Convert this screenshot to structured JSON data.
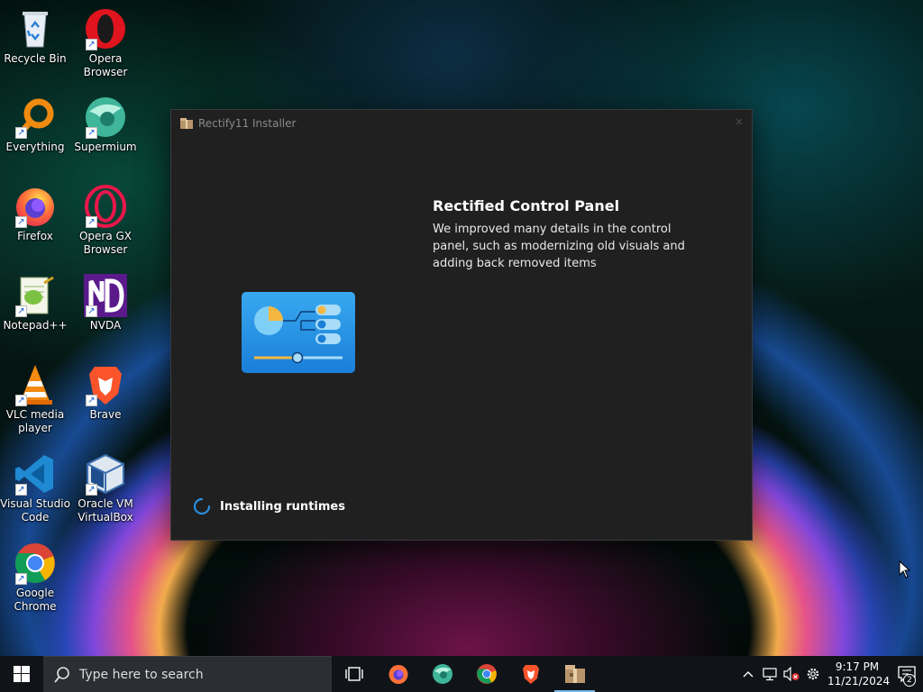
{
  "desktop": {
    "icons": [
      {
        "label": "Recycle Bin",
        "icon": "recycle-bin-icon",
        "shortcut": false
      },
      {
        "label": "Opera Browser",
        "icon": "opera-icon",
        "shortcut": true
      },
      {
        "label": "Everything",
        "icon": "everything-icon",
        "shortcut": true
      },
      {
        "label": "Supermium",
        "icon": "supermium-icon",
        "shortcut": true
      },
      {
        "label": "Firefox",
        "icon": "firefox-icon",
        "shortcut": true
      },
      {
        "label": "Opera GX Browser",
        "icon": "opera-gx-icon",
        "shortcut": true
      },
      {
        "label": "Notepad++",
        "icon": "notepad-plus-plus-icon",
        "shortcut": true
      },
      {
        "label": "NVDA",
        "icon": "nvda-icon",
        "shortcut": true
      },
      {
        "label": "VLC media player",
        "icon": "vlc-icon",
        "shortcut": true
      },
      {
        "label": "Brave",
        "icon": "brave-icon",
        "shortcut": true
      },
      {
        "label": "Visual Studio Code",
        "icon": "vscode-icon",
        "shortcut": true
      },
      {
        "label": "Oracle VM VirtualBox",
        "icon": "virtualbox-icon",
        "shortcut": true
      },
      {
        "label": "Google Chrome",
        "icon": "chrome-icon",
        "shortcut": true
      }
    ]
  },
  "installer": {
    "title": "Rectify11 Installer",
    "feature_title": "Rectified Control Panel",
    "feature_description": "We improved many details in the control panel, such as modernizing old visuals and adding back removed items",
    "status": "Installing runtimes",
    "accent": "#2a8fe0"
  },
  "taskbar": {
    "search_placeholder": "Type here to search",
    "apps": [
      {
        "name": "task-view",
        "icon": "task-view-icon"
      },
      {
        "name": "firefox",
        "icon": "firefox-icon"
      },
      {
        "name": "supermium",
        "icon": "supermium-icon"
      },
      {
        "name": "chrome",
        "icon": "chrome-icon"
      },
      {
        "name": "brave",
        "icon": "brave-icon"
      },
      {
        "name": "rectify11-installer",
        "icon": "installer-icon",
        "active": true
      }
    ],
    "clock_time": "9:17 PM",
    "clock_date": "11/21/2024",
    "notification_count": "2"
  }
}
